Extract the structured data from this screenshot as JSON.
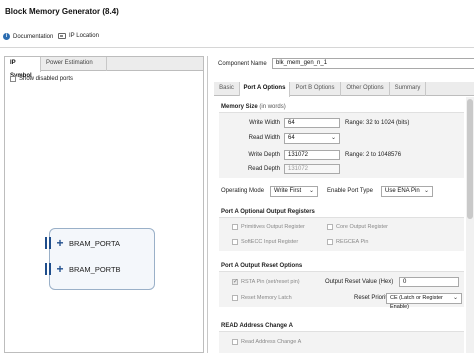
{
  "window": {
    "title": "Block Memory Generator (8.4)"
  },
  "toolbar": {
    "documentation": "Documentation",
    "ip_location": "IP Location"
  },
  "left_panel": {
    "tabs": [
      {
        "label": "IP Symbol",
        "active": true
      },
      {
        "label": "Power Estimation",
        "active": false
      }
    ],
    "show_disabled_ports": "Show disabled ports",
    "ports": [
      "BRAM_PORTA",
      "BRAM_PORTB"
    ]
  },
  "component": {
    "label": "Component Name",
    "value": "blk_mem_gen_n_1"
  },
  "right_tabs": [
    {
      "label": "Basic",
      "active": false
    },
    {
      "label": "Port A Options",
      "active": true
    },
    {
      "label": "Port B Options",
      "active": false
    },
    {
      "label": "Other Options",
      "active": false
    },
    {
      "label": "Summary",
      "active": false
    }
  ],
  "memory_size": {
    "header": "Memory Size",
    "header_unit": "(in words)",
    "write_width": {
      "label": "Write Width",
      "value": "64",
      "note": "Range: 32 to 1024 (bits)"
    },
    "read_width": {
      "label": "Read Width",
      "value": "64"
    },
    "write_depth": {
      "label": "Write Depth",
      "value": "131072",
      "note": "Range: 2 to 1048576"
    },
    "read_depth": {
      "label": "Read Depth",
      "value": "131072"
    }
  },
  "operating_mode": {
    "label": "Operating Mode",
    "value": "Write First"
  },
  "enable_port_type": {
    "label": "Enable Port Type",
    "value": "Use ENA Pin"
  },
  "optional_output_registers": {
    "header": "Port A Optional Output Registers",
    "primitives": "Primitives Output Register",
    "core": "Core Output Register",
    "softecc": "SoftECC Input Register",
    "regcea": "REGCEA Pin"
  },
  "output_reset": {
    "header": "Port A Output Reset Options",
    "rsta_pin": "RSTA Pin (set/reset pin)",
    "reset_value_label": "Output Reset Value (Hex)",
    "reset_value": "0",
    "reset_memory_latch": "Reset Memory Latch",
    "reset_priority_label": "Reset Priority",
    "reset_priority_value": "CE (Latch or Register Enable)"
  },
  "read_address_change": {
    "header": "READ Address Change A",
    "checkbox": "Read Address Change A"
  },
  "colors": {
    "accent": "#1f4e8c",
    "panel_bg": "#f3f3f3"
  }
}
